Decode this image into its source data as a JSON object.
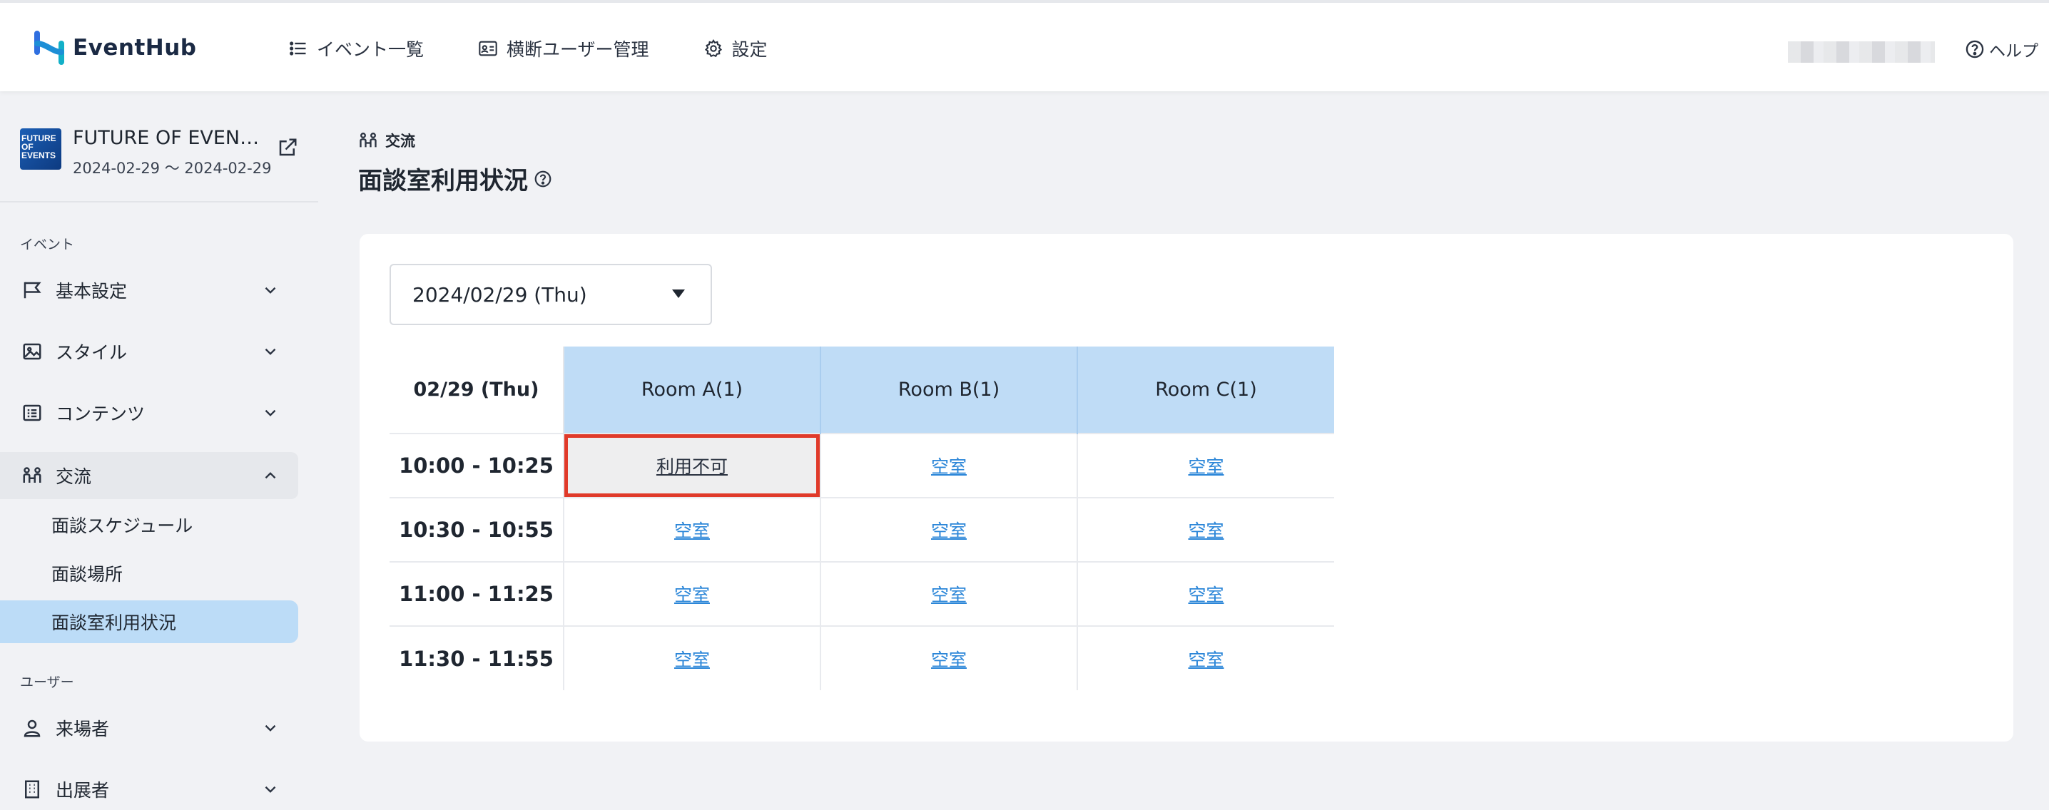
{
  "header": {
    "logo_text": "EventHub",
    "nav": [
      {
        "label": "イベント一覧",
        "icon": "list-icon"
      },
      {
        "label": "横断ユーザー管理",
        "icon": "id-card-icon"
      },
      {
        "label": "設定",
        "icon": "gear-icon"
      }
    ],
    "help_label": "ヘルプ"
  },
  "sidebar": {
    "event": {
      "title": "FUTURE OF EVEN…",
      "dates": "2024-02-29 〜 2024-02-29",
      "thumb_text": "FUTURE OF EVENTS"
    },
    "section_event_label": "イベント",
    "items": [
      {
        "label": "基本設定",
        "icon": "flag-icon"
      },
      {
        "label": "スタイル",
        "icon": "image-icon"
      },
      {
        "label": "コンテンツ",
        "icon": "list-box-icon"
      },
      {
        "label": "交流",
        "icon": "people-icon"
      }
    ],
    "sub_items": [
      {
        "label": "面談スケジュール"
      },
      {
        "label": "面談場所"
      },
      {
        "label": "面談室利用状況"
      }
    ],
    "section_user_label": "ユーザー",
    "user_items": [
      {
        "label": "来場者",
        "icon": "person-icon"
      },
      {
        "label": "出展者",
        "icon": "building-icon"
      }
    ]
  },
  "main": {
    "breadcrumb": "交流",
    "title": "面談室利用状況",
    "date_select_value": "2024/02/29 (Thu)",
    "table": {
      "corner": "02/29 (Thu)",
      "rooms": [
        "Room A(1)",
        "Room B(1)",
        "Room C(1)"
      ],
      "rows": [
        {
          "time": "10:00 - 10:25",
          "cells": [
            "利用不可",
            "空室",
            "空室"
          ]
        },
        {
          "time": "10:30 - 10:55",
          "cells": [
            "空室",
            "空室",
            "空室"
          ]
        },
        {
          "time": "11:00 - 11:25",
          "cells": [
            "空室",
            "空室",
            "空室"
          ]
        },
        {
          "time": "11:30 - 11:55",
          "cells": [
            "空室",
            "空室",
            "空室"
          ]
        }
      ]
    }
  },
  "colors": {
    "accent": "#2b86d8",
    "room_header_bg": "#bfdcf6",
    "active_nav_bg": "#bcdcf7",
    "highlight_border": "#e03a2a"
  }
}
